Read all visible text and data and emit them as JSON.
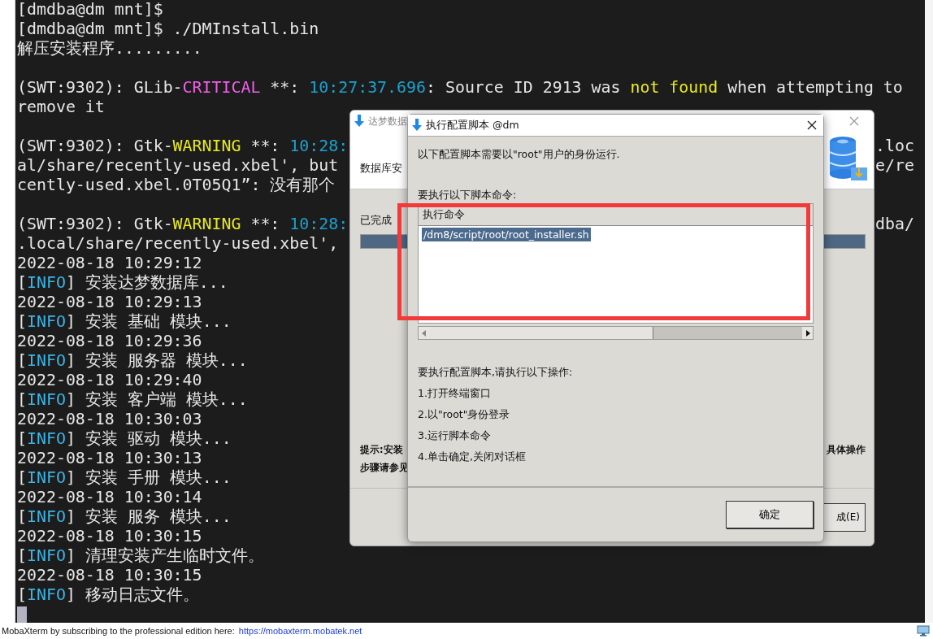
{
  "terminal": {
    "lines": [
      {
        "kind": "text",
        "segments": [
          {
            "text": "[dmdba@dm mnt]$",
            "color": "#e6e6e6"
          }
        ]
      },
      {
        "segments": [
          {
            "text": "[dmdba@dm mnt]$ ./DMInstall.bin",
            "color": "#e6e6e6"
          }
        ]
      },
      {
        "segments": [
          {
            "text": "解压安装程序.........",
            "color": "#e6e6e6"
          }
        ]
      },
      {
        "kind": "blank"
      },
      {
        "segments": [
          {
            "text": "(SWT:9302): GLib-",
            "color": "#e6e6e6"
          },
          {
            "text": "CRITICAL",
            "color": "#ef5fe8"
          },
          {
            "text": " **: ",
            "color": "#e6e6e6"
          },
          {
            "text": "10:27:37.696",
            "color": "#1ba1cf"
          },
          {
            "text": ": Source ID 2913 was ",
            "color": "#e6e6e6"
          },
          {
            "text": "not found",
            "color": "#e8e820"
          },
          {
            "text": " when attempting to",
            "color": "#e6e6e6"
          }
        ]
      },
      {
        "segments": [
          {
            "text": "remove it",
            "color": "#e6e6e6"
          }
        ]
      },
      {
        "kind": "blank"
      },
      {
        "segments": [
          {
            "text": "(SWT:9302): Gtk-",
            "color": "#e6e6e6"
          },
          {
            "text": "WARNING",
            "color": "#e8e820"
          },
          {
            "text": " **: ",
            "color": "#e6e6e6"
          },
          {
            "text": "10:28:",
            "color": "#1ba1cf"
          }
        ],
        "right_text": ".loc"
      },
      {
        "segments": [
          {
            "text": "al/share/recently-used.xbel', but",
            "color": "#e6e6e6"
          }
        ],
        "right_text": "e/re"
      },
      {
        "segments": [
          {
            "text": "cently-used.xbel.0T05Q1”: 没有那个",
            "color": "#e6e6e6"
          }
        ]
      },
      {
        "kind": "blank"
      },
      {
        "segments": [
          {
            "text": "(SWT:9302): Gtk-",
            "color": "#e6e6e6"
          },
          {
            "text": "WARNING",
            "color": "#e8e820"
          },
          {
            "text": " **: ",
            "color": "#e6e6e6"
          },
          {
            "text": "10:28:",
            "color": "#1ba1cf"
          }
        ],
        "right_text": "dba/"
      },
      {
        "segments": [
          {
            "text": ".local/share/recently-used.xbel',",
            "color": "#e6e6e6"
          }
        ]
      },
      {
        "segments": [
          {
            "text": "2022-08-18 10:29:12",
            "color": "#e6e6e6"
          }
        ]
      },
      {
        "segments": [
          {
            "text": "[",
            "color": "#e6e6e6"
          },
          {
            "text": "INFO",
            "color": "#3cb4e6"
          },
          {
            "text": "] 安装达梦数据库...",
            "color": "#e6e6e6"
          }
        ]
      },
      {
        "segments": [
          {
            "text": "2022-08-18 10:29:13",
            "color": "#e6e6e6"
          }
        ]
      },
      {
        "segments": [
          {
            "text": "[",
            "color": "#e6e6e6"
          },
          {
            "text": "INFO",
            "color": "#3cb4e6"
          },
          {
            "text": "] 安装 基础 模块...",
            "color": "#e6e6e6"
          }
        ]
      },
      {
        "segments": [
          {
            "text": "2022-08-18 10:29:36",
            "color": "#e6e6e6"
          }
        ]
      },
      {
        "segments": [
          {
            "text": "[",
            "color": "#e6e6e6"
          },
          {
            "text": "INFO",
            "color": "#3cb4e6"
          },
          {
            "text": "] 安装 服务器 模块...",
            "color": "#e6e6e6"
          }
        ]
      },
      {
        "segments": [
          {
            "text": "2022-08-18 10:29:40",
            "color": "#e6e6e6"
          }
        ]
      },
      {
        "segments": [
          {
            "text": "[",
            "color": "#e6e6e6"
          },
          {
            "text": "INFO",
            "color": "#3cb4e6"
          },
          {
            "text": "] 安装 客户端 模块...",
            "color": "#e6e6e6"
          }
        ]
      },
      {
        "segments": [
          {
            "text": "2022-08-18 10:30:03",
            "color": "#e6e6e6"
          }
        ]
      },
      {
        "segments": [
          {
            "text": "[",
            "color": "#e6e6e6"
          },
          {
            "text": "INFO",
            "color": "#3cb4e6"
          },
          {
            "text": "] 安装 驱动 模块...",
            "color": "#e6e6e6"
          }
        ]
      },
      {
        "segments": [
          {
            "text": "2022-08-18 10:30:13",
            "color": "#e6e6e6"
          }
        ]
      },
      {
        "segments": [
          {
            "text": "[",
            "color": "#e6e6e6"
          },
          {
            "text": "INFO",
            "color": "#3cb4e6"
          },
          {
            "text": "] 安装 手册 模块...",
            "color": "#e6e6e6"
          }
        ]
      },
      {
        "segments": [
          {
            "text": "2022-08-18 10:30:14",
            "color": "#e6e6e6"
          }
        ]
      },
      {
        "segments": [
          {
            "text": "[",
            "color": "#e6e6e6"
          },
          {
            "text": "INFO",
            "color": "#3cb4e6"
          },
          {
            "text": "] 安装 服务 模块...",
            "color": "#e6e6e6"
          }
        ]
      },
      {
        "segments": [
          {
            "text": "2022-08-18 10:30:15",
            "color": "#e6e6e6"
          }
        ]
      },
      {
        "segments": [
          {
            "text": "[",
            "color": "#e6e6e6"
          },
          {
            "text": "INFO",
            "color": "#3cb4e6"
          },
          {
            "text": "] 清理安装产生临时文件。",
            "color": "#e6e6e6"
          }
        ]
      },
      {
        "segments": [
          {
            "text": "2022-08-18 10:30:15",
            "color": "#e6e6e6"
          }
        ]
      },
      {
        "segments": [
          {
            "text": "[",
            "color": "#e6e6e6"
          },
          {
            "text": "INFO",
            "color": "#3cb4e6"
          },
          {
            "text": "] 移动日志文件。",
            "color": "#e6e6e6"
          }
        ]
      }
    ]
  },
  "installer_window": {
    "title": "达梦数据",
    "header": "数据库安",
    "progress_label": "已完成",
    "progress": {
      "level": 1
    },
    "hint_left": [
      "提示:安装",
      "步骤请参见"
    ],
    "hint_right": "具体操作",
    "button": "成(E)"
  },
  "script_dialog": {
    "title": "执行配置脚本 @dm",
    "intro": "以下配置脚本需要以\"root\"用户的身份运行.",
    "table_label": "要执行以下脚本命令:",
    "table": {
      "columns": [
        "执行命令"
      ],
      "rows": [
        {
          "command": "/dm8/script/root/root_installer.sh",
          "selected": true
        }
      ]
    },
    "steps_title": "要执行配置脚本,请执行以下操作:",
    "steps": [
      "1.打开终端窗口",
      "2.以\"root\"身份登录",
      "3.运行脚本命令",
      "4.单击确定,关闭对话框"
    ],
    "ok_button": "确定"
  },
  "status_bar": {
    "text": "MobaXterm by subscribing to the professional edition here:",
    "link": "https://mobaxterm.mobatek.net"
  }
}
